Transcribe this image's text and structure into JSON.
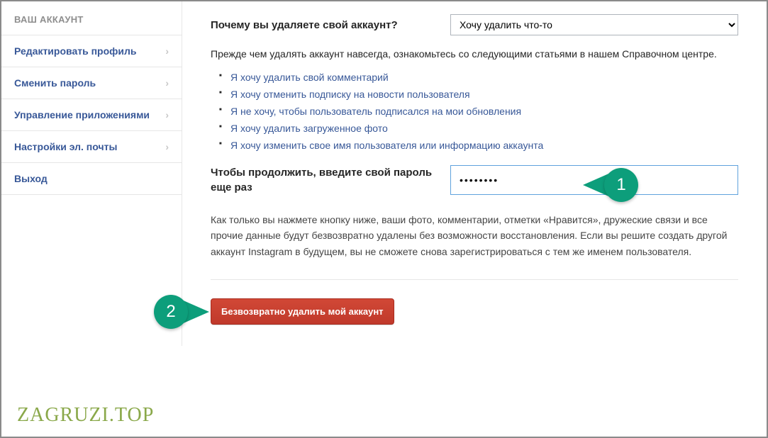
{
  "sidebar": {
    "header": "ВАШ АККАУНТ",
    "items": [
      {
        "label": "Редактировать профиль"
      },
      {
        "label": "Сменить пароль"
      },
      {
        "label": "Управление приложениями"
      },
      {
        "label": "Настройки эл. почты"
      }
    ],
    "logout": "Выход"
  },
  "main": {
    "question_label": "Почему вы удаляете свой аккаунт?",
    "reason_selected": "Хочу удалить что-то",
    "intro": "Прежде чем удалять аккаунт навсегда, ознакомьтесь со следующими статьями в нашем Справочном центре.",
    "help_links": [
      "Я хочу удалить свой комментарий",
      "Я хочу отменить подписку на новости пользователя",
      "Я не хочу, чтобы пользователь подписался на мои обновления",
      "Я хочу удалить загруженное фото",
      "Я хочу изменить свое имя пользователя или информацию аккаунта"
    ],
    "password_label": "Чтобы продолжить, введите свой пароль еще раз",
    "password_value": "••••••••",
    "warning": "Как только вы нажмете кнопку ниже, ваши фото, комментарии, отметки «Нравится», дружеские связи и все прочие данные будут безвозвратно удалены без возможности восстановления. Если вы решите создать другой аккаунт Instagram в будущем, вы не сможете снова зарегистрироваться с тем же именем пользователя.",
    "delete_button": "Безвозвратно удалить мой аккаунт"
  },
  "callouts": {
    "one": "1",
    "two": "2"
  },
  "watermark": "ZAGRUZI.TOP"
}
